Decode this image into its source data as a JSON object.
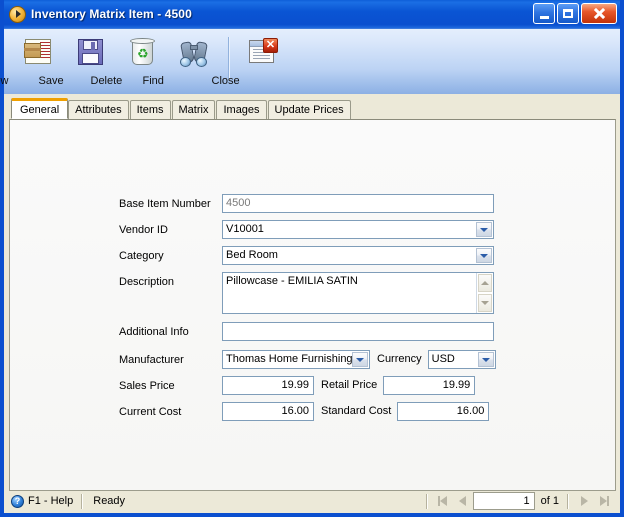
{
  "window": {
    "title": "Inventory Matrix Item - 4500",
    "icon": "orange-ball-icon",
    "minimize_label": "Minimize",
    "maximize_label": "Maximize",
    "close_label": "Close"
  },
  "toolbar": {
    "buttons": [
      {
        "label": "New",
        "icon": "new-document-icon"
      },
      {
        "label": "Save",
        "icon": "floppy-disk-icon"
      },
      {
        "label": "Delete",
        "icon": "recycle-bin-icon"
      },
      {
        "label": "Find",
        "icon": "binoculars-icon"
      },
      {
        "label": "Close",
        "icon": "close-window-icon"
      }
    ],
    "close_badge": "✕"
  },
  "tabs": [
    {
      "label": "General",
      "active": true
    },
    {
      "label": "Attributes",
      "active": false
    },
    {
      "label": "Items",
      "active": false
    },
    {
      "label": "Matrix",
      "active": false
    },
    {
      "label": "Images",
      "active": false
    },
    {
      "label": "Update Prices",
      "active": false
    }
  ],
  "form": {
    "base_item_number": {
      "label": "Base Item Number",
      "value": "4500",
      "readonly": true
    },
    "vendor_id": {
      "label": "Vendor ID",
      "value": "V10001"
    },
    "category": {
      "label": "Category",
      "value": "Bed Room"
    },
    "description": {
      "label": "Description",
      "value": "Pillowcase - EMILIA SATIN"
    },
    "additional_info": {
      "label": "Additional Info",
      "value": ""
    },
    "manufacturer": {
      "label": "Manufacturer",
      "value": "Thomas Home Furnishing M"
    },
    "currency": {
      "label": "Currency",
      "value": "USD"
    },
    "sales_price": {
      "label": "Sales Price",
      "value": "19.99"
    },
    "retail_price": {
      "label": "Retail Price",
      "value": "19.99"
    },
    "current_cost": {
      "label": "Current Cost",
      "value": "16.00"
    },
    "standard_cost": {
      "label": "Standard Cost",
      "value": "16.00"
    }
  },
  "statusbar": {
    "help_icon": "question-mark-icon",
    "help_label": "F1 - Help",
    "status": "Ready"
  },
  "navigator": {
    "first_label": "First record",
    "prev_label": "Previous record",
    "record": "1",
    "of_text": "of  1",
    "next_label": "Next record",
    "last_label": "Last record"
  },
  "colors": {
    "title_blue": "#0a4fcf",
    "toolbar_top": "#e4eefc",
    "toolbar_bottom": "#8cb0e4",
    "tab_face": "#ece9d8",
    "active_tab_accent": "#f0a000",
    "field_border": "#7f9db9",
    "panel_bg": "#f8f8f6"
  }
}
